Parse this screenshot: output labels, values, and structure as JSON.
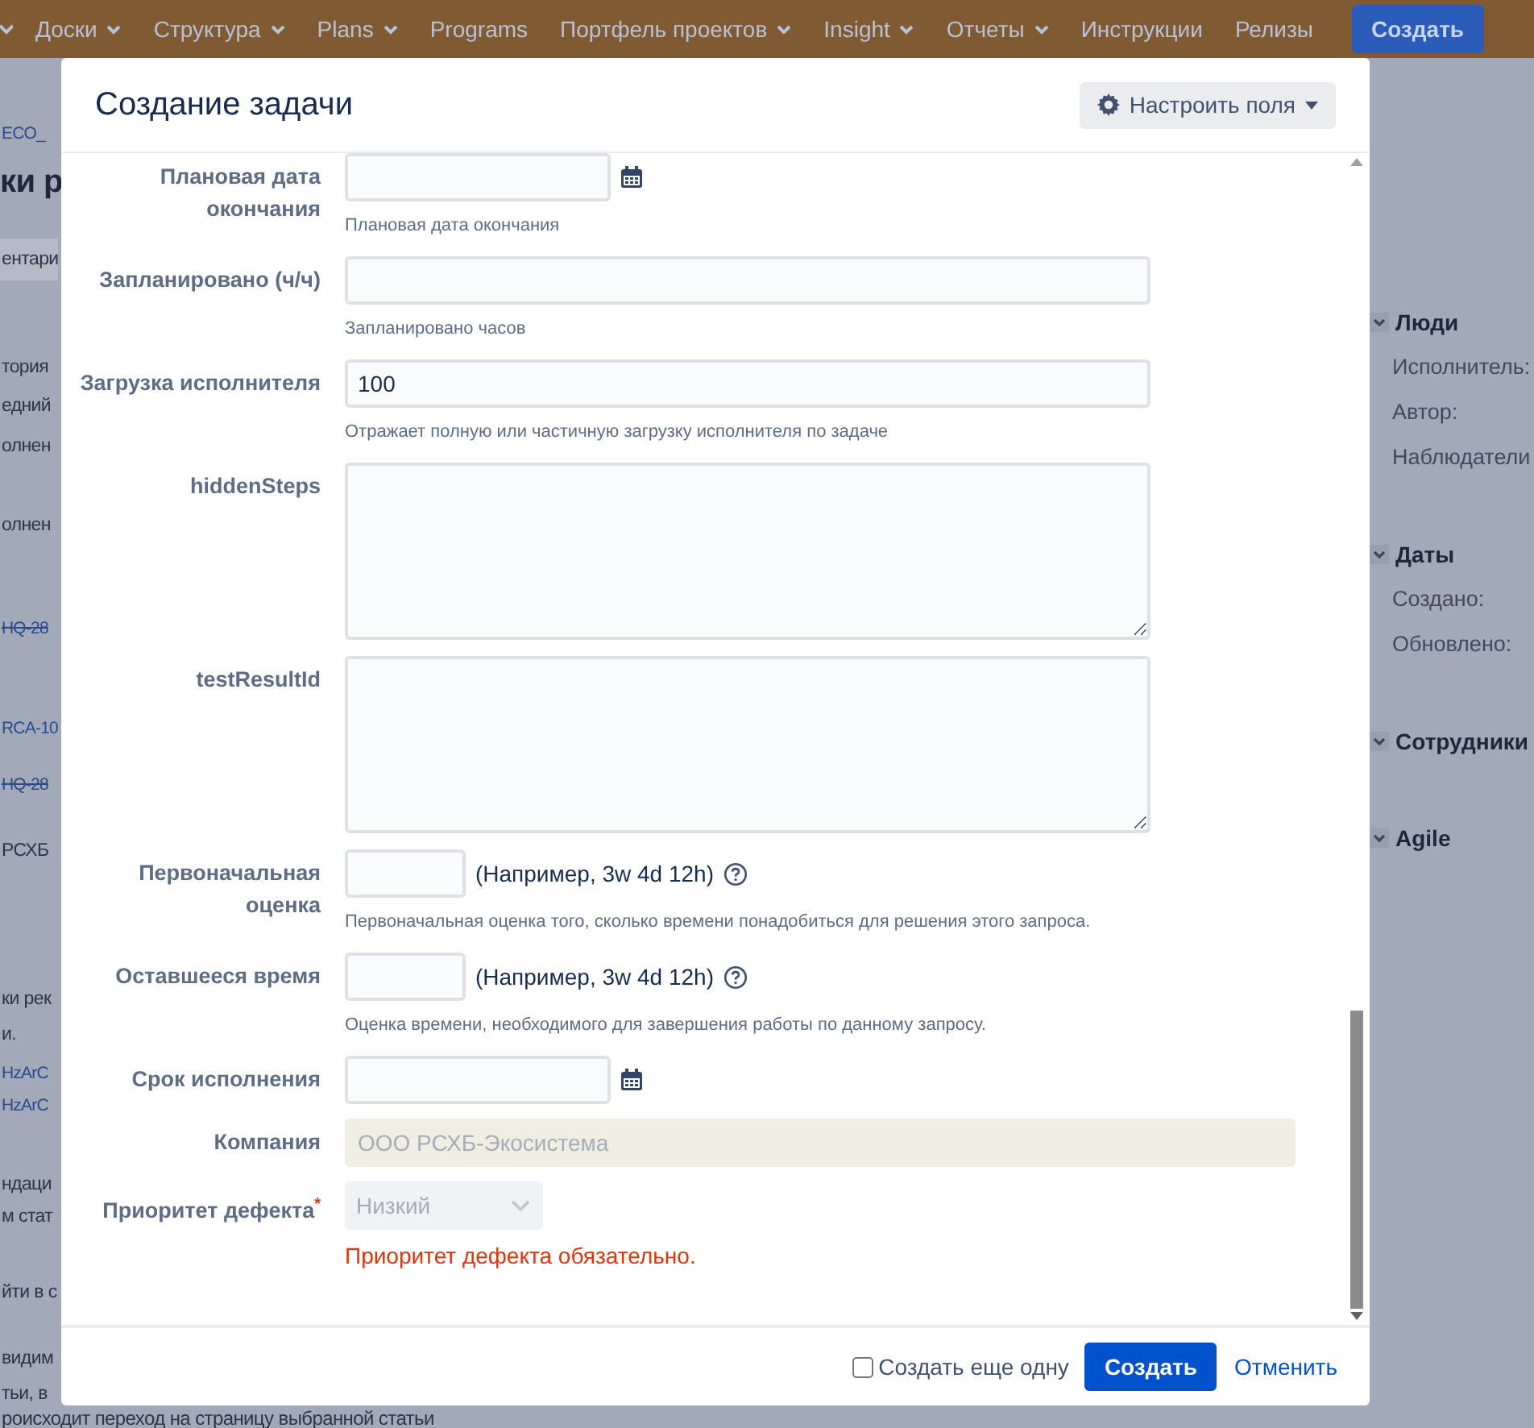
{
  "background": {
    "nav": [
      {
        "label": "Доски",
        "has_menu": true
      },
      {
        "label": "Структура",
        "has_menu": true
      },
      {
        "label": "Plans",
        "has_menu": true
      },
      {
        "label": "Programs",
        "has_menu": false
      },
      {
        "label": "Портфель проектов",
        "has_menu": true
      },
      {
        "label": "Insight",
        "has_menu": true
      },
      {
        "label": "Отчеты",
        "has_menu": true
      },
      {
        "label": "Инструкции",
        "has_menu": false
      },
      {
        "label": "Релизы",
        "has_menu": false
      }
    ],
    "create_button": "Создать",
    "left_fragments": [
      {
        "kind": "link",
        "text": "ECO_",
        "resolved": false
      },
      {
        "kind": "heading",
        "text": "ки р"
      },
      {
        "kind": "tab",
        "text": "ентари"
      },
      {
        "kind": "text",
        "text": "тория"
      },
      {
        "kind": "text",
        "text": "едний"
      },
      {
        "kind": "text",
        "text": "олнен"
      },
      {
        "kind": "text",
        "text": "олнен"
      },
      {
        "kind": "link",
        "text": "HQ-28",
        "resolved": true
      },
      {
        "kind": "link",
        "text": "RCA-10",
        "resolved": false
      },
      {
        "kind": "link",
        "text": "HQ-28",
        "resolved": true
      },
      {
        "kind": "text",
        "text": "РСХБ"
      },
      {
        "kind": "text",
        "text": "ки рек"
      },
      {
        "kind": "text",
        "text": "и."
      },
      {
        "kind": "link",
        "text": "HzArC",
        "resolved": false
      },
      {
        "kind": "link",
        "text": "HzArC",
        "resolved": false
      },
      {
        "kind": "text",
        "text": "ндаци"
      },
      {
        "kind": "text",
        "text": "м стат"
      },
      {
        "kind": "text",
        "text": "йти в с"
      },
      {
        "kind": "text",
        "text": "видим"
      },
      {
        "kind": "text",
        "text": "тьи, в"
      },
      {
        "kind": "text",
        "text": "роисходит переход на страницу выбранной статьи"
      }
    ],
    "sidebar": [
      {
        "title": "Люди",
        "items": [
          "Исполнитель:",
          "Автор:",
          "Наблюдатели"
        ]
      },
      {
        "title": "Даты",
        "items": [
          "Создано:",
          "Обновлено:"
        ]
      },
      {
        "title": "Сотрудники"
      },
      {
        "title": "Agile"
      }
    ]
  },
  "dialog": {
    "title": "Создание задачи",
    "configure_button": "Настроить поля",
    "fields": [
      {
        "kind": "date",
        "label": "Плановая дата окончания",
        "description": "Плановая дата окончания"
      },
      {
        "kind": "text",
        "label": "Запланировано (ч/ч)",
        "description": "Запланировано часов"
      },
      {
        "kind": "text",
        "label": "Загрузка исполнителя",
        "value": "100",
        "description": "Отражает полную или частичную загрузку исполнителя по задаче"
      },
      {
        "kind": "textarea",
        "label": "hiddenSteps"
      },
      {
        "kind": "textarea",
        "label": "testResultId"
      },
      {
        "kind": "duration",
        "label": "Первоначальная оценка",
        "hint": "(Например, 3w 4d 12h)",
        "description": "Первоначальная оценка того, сколько времени понадобиться для решения этого запроса."
      },
      {
        "kind": "duration",
        "label": "Оставшееся время",
        "hint": "(Например, 3w 4d 12h)",
        "description": "Оценка времени, необходимого для завершения работы по данному запросу."
      },
      {
        "kind": "date",
        "label": "Срок исполнения"
      },
      {
        "kind": "readonly",
        "label": "Компания",
        "value": "ООО РСХБ-Экосистема"
      },
      {
        "kind": "select",
        "label": "Приоритет дефекта",
        "required_mark": "*",
        "value": "Низкий",
        "error": "Приоритет дефекта обязательно."
      }
    ],
    "create_another": {
      "label": "Создать еще одну",
      "checked": false
    },
    "submit_button": "Создать",
    "cancel_link": "Отменить"
  }
}
